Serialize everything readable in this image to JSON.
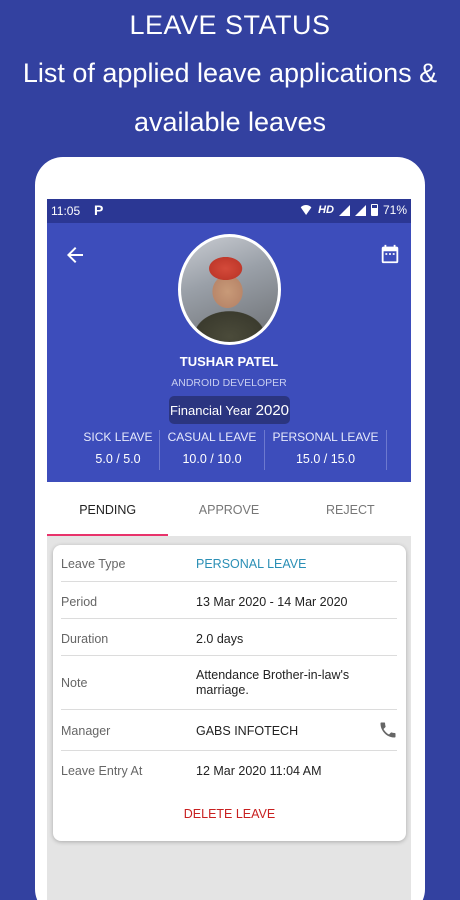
{
  "promo": {
    "line1": "LEAVE STATUS",
    "line2": "List of applied leave applications &",
    "line3": "available leaves"
  },
  "status_bar": {
    "time": "11:05",
    "app_icon": "P",
    "network": "HD",
    "battery": "71%"
  },
  "profile": {
    "name": "TUSHAR PATEL",
    "role": "ANDROID DEVELOPER",
    "financial_year_label": "Financial Year",
    "financial_year": "2020"
  },
  "balances": [
    {
      "label": "SICK LEAVE",
      "value": "5.0 / 5.0"
    },
    {
      "label": "CASUAL LEAVE",
      "value": "10.0 / 10.0"
    },
    {
      "label": "PERSONAL LEAVE",
      "value": "15.0 / 15.0"
    }
  ],
  "tabs": [
    {
      "label": "PENDING",
      "active": true
    },
    {
      "label": "APPROVE",
      "active": false
    },
    {
      "label": "REJECT",
      "active": false
    }
  ],
  "leave": {
    "type_label": "Leave Type",
    "type": "PERSONAL LEAVE",
    "period_label": "Period",
    "period": "13 Mar 2020 - 14 Mar 2020",
    "duration_label": "Duration",
    "duration": "2.0 days",
    "note_label": "Note",
    "note": "Attendance Brother-in-law's marriage.",
    "manager_label": "Manager",
    "manager": "GABS INFOTECH",
    "entry_label": "Leave Entry At",
    "entry": "12 Mar 2020 11:04 AM",
    "delete_label": "DELETE LEAVE"
  },
  "colors": {
    "background": "#3341a0",
    "header": "#3d4dbb",
    "tab_indicator": "#e8336b",
    "leave_type": "#2a8fb5",
    "delete": "#c82020"
  }
}
